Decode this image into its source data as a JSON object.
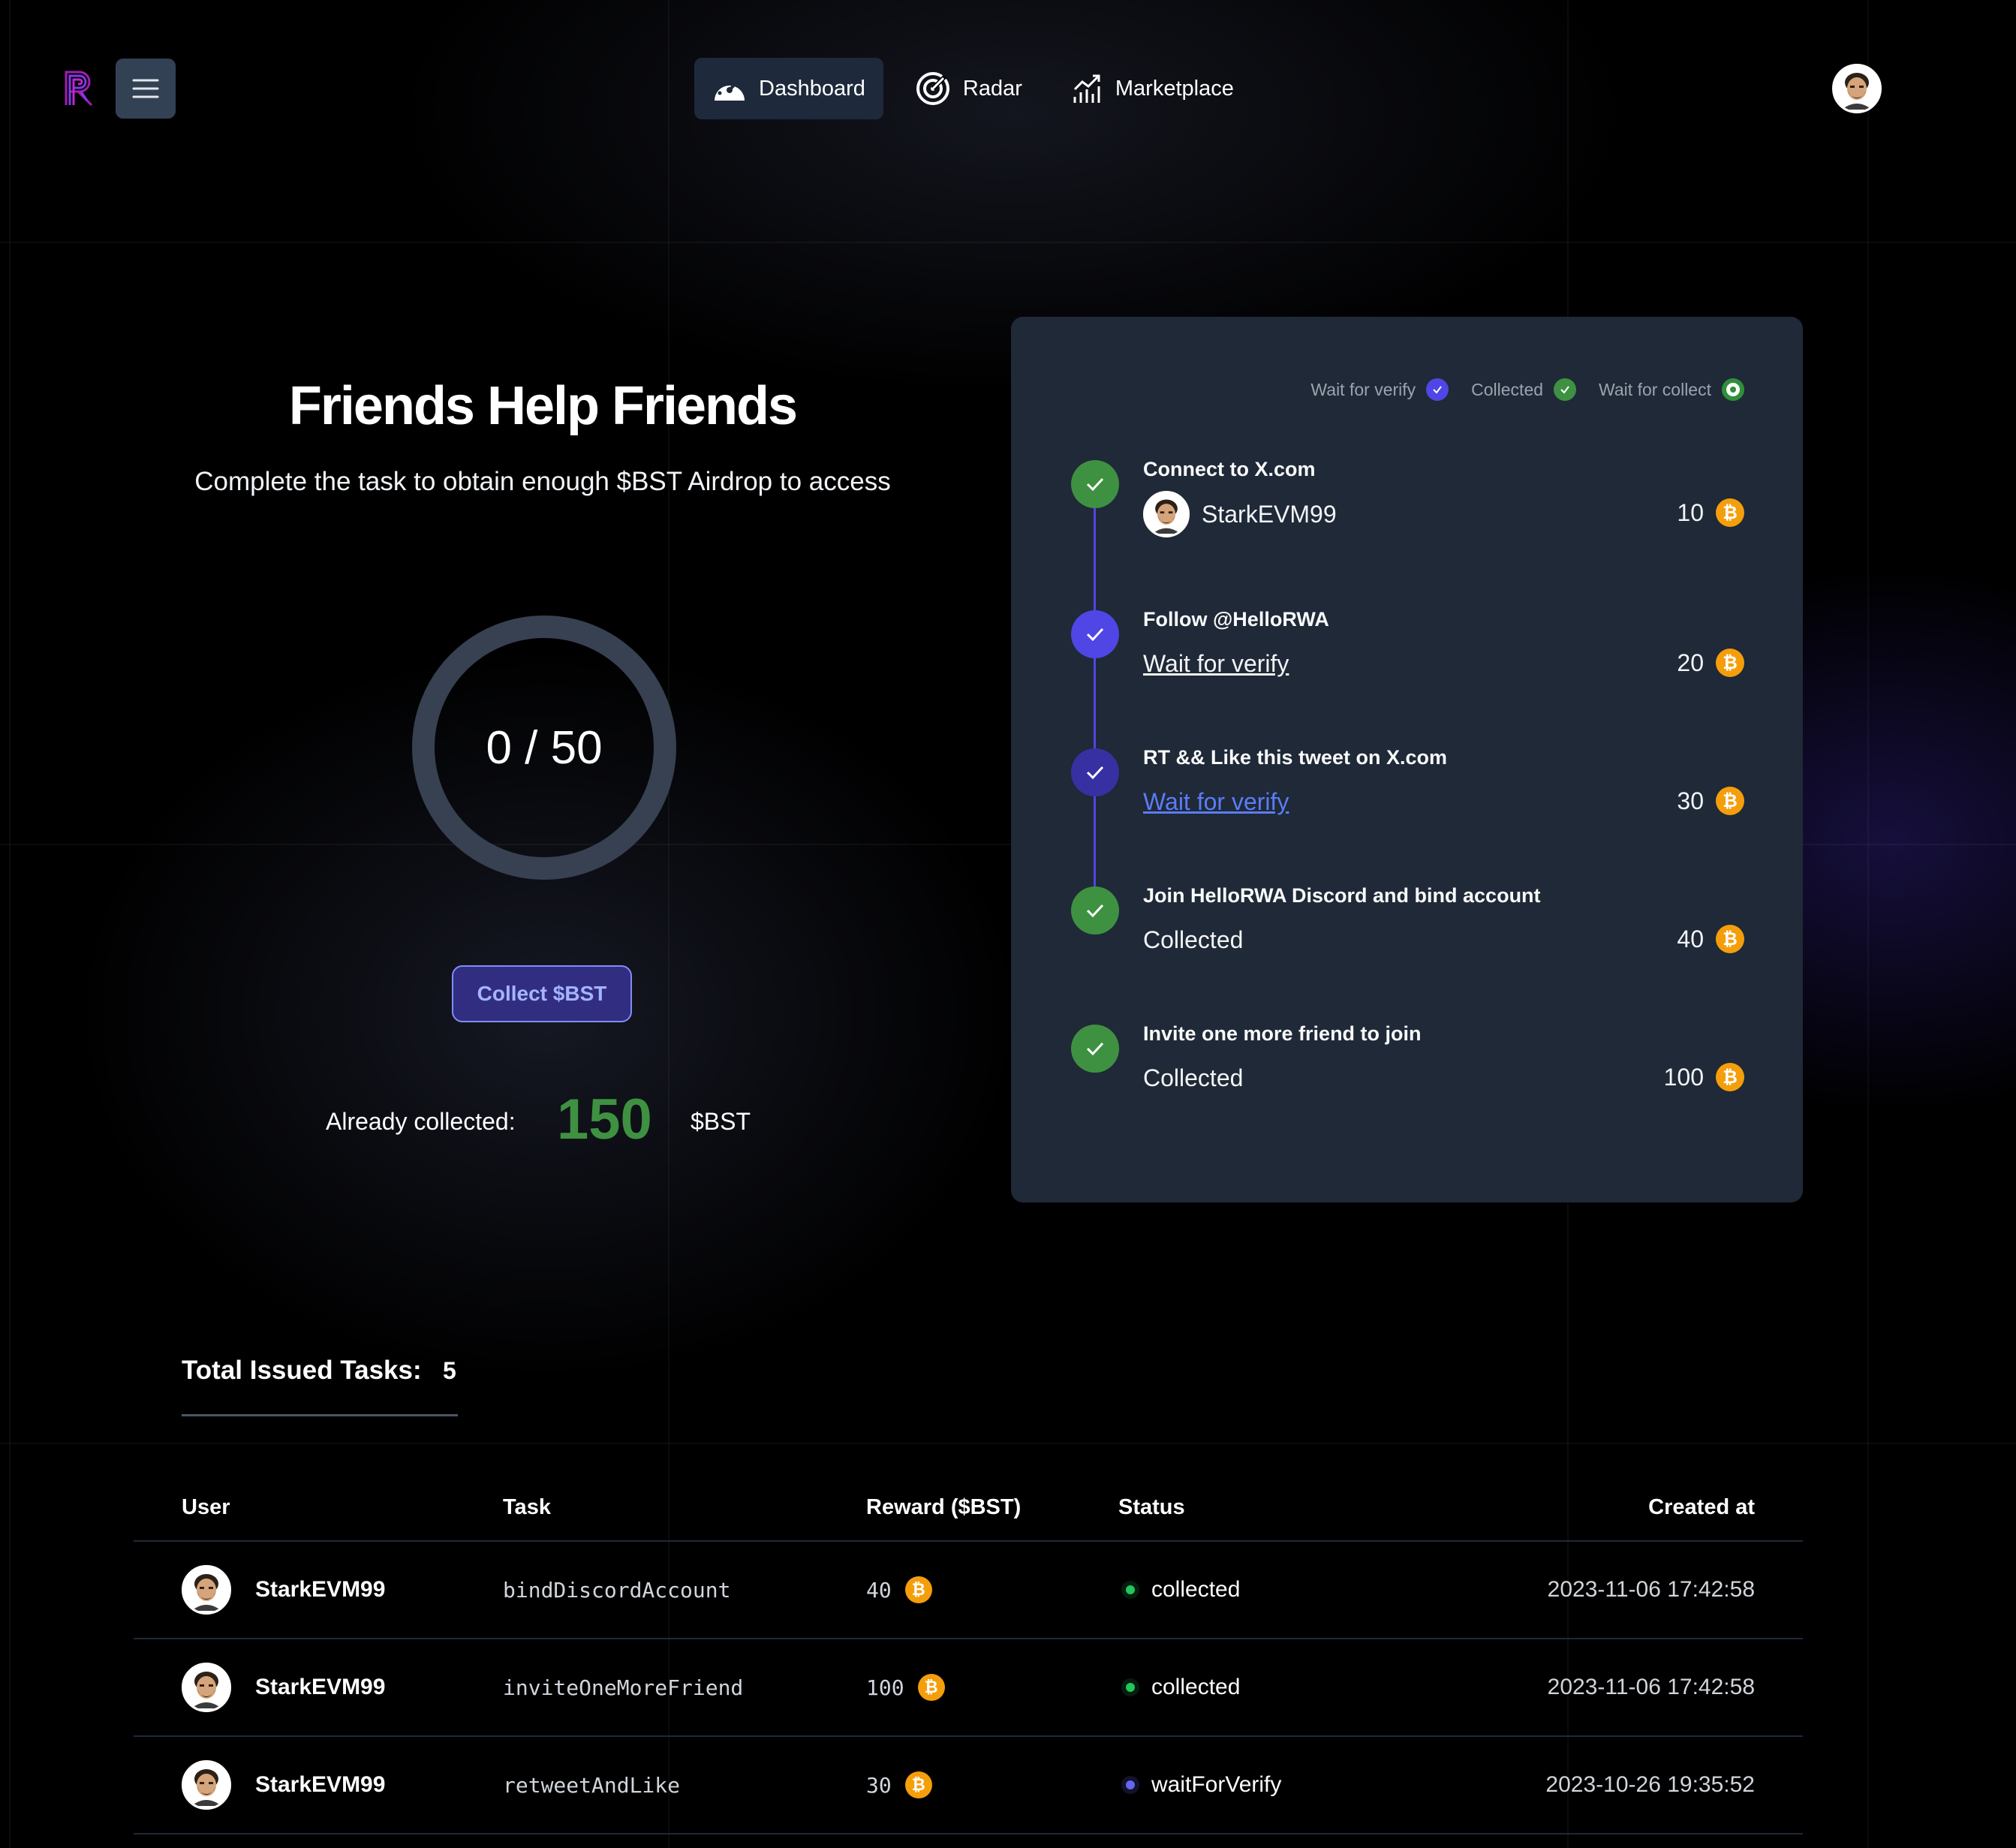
{
  "header": {
    "nav": [
      {
        "label": "Dashboard",
        "icon": "dashboard-icon",
        "active": true
      },
      {
        "label": "Radar",
        "icon": "radar-icon",
        "active": false
      },
      {
        "label": "Marketplace",
        "icon": "marketplace-chart-icon",
        "active": false
      }
    ]
  },
  "hero": {
    "title": "Friends Help Friends",
    "subtitle": "Complete the task to obtain enough $BST Airdrop to access",
    "progress_text": "0 / 50",
    "collect_button": "Collect $BST",
    "already_collected_label": "Already collected:",
    "already_collected_value": "150",
    "already_collected_unit": "$BST"
  },
  "panel": {
    "legend": {
      "wait_for_verify": "Wait for verify",
      "collected": "Collected",
      "wait_for_collect": "Wait for collect"
    },
    "steps": [
      {
        "title": "Connect to X.com",
        "status": "StarkEVM99",
        "reward": "10"
      },
      {
        "title": "Follow @HelloRWA",
        "status": "Wait for verify",
        "reward": "20"
      },
      {
        "title": "RT && Like this tweet on X.com",
        "status": "Wait for verify",
        "reward": "30"
      },
      {
        "title": "Join HelloRWA Discord and bind account",
        "status": "Collected",
        "reward": "40"
      },
      {
        "title": "Invite one more friend to join",
        "status": "Collected",
        "reward": "100"
      }
    ]
  },
  "tasks": {
    "total_label": "Total Issued Tasks:",
    "total_value": "5",
    "columns": {
      "user": "User",
      "task": "Task",
      "reward": "Reward ($BST)",
      "status": "Status",
      "created": "Created at"
    },
    "rows": [
      {
        "user": "StarkEVM99",
        "task": "bindDiscordAccount",
        "reward": "40",
        "status": "collected",
        "created": "2023-11-06 17:42:58"
      },
      {
        "user": "StarkEVM99",
        "task": "inviteOneMoreFriend",
        "reward": "100",
        "status": "collected",
        "created": "2023-11-06 17:42:58"
      },
      {
        "user": "StarkEVM99",
        "task": "retweetAndLike",
        "reward": "30",
        "status": "waitForVerify",
        "created": "2023-10-26 19:35:52"
      }
    ]
  },
  "colors": {
    "accent_indigo": "#4f46e5",
    "success_green": "#3f9142",
    "coin_orange": "#f59e0b",
    "panel_bg": "#1f2937"
  }
}
